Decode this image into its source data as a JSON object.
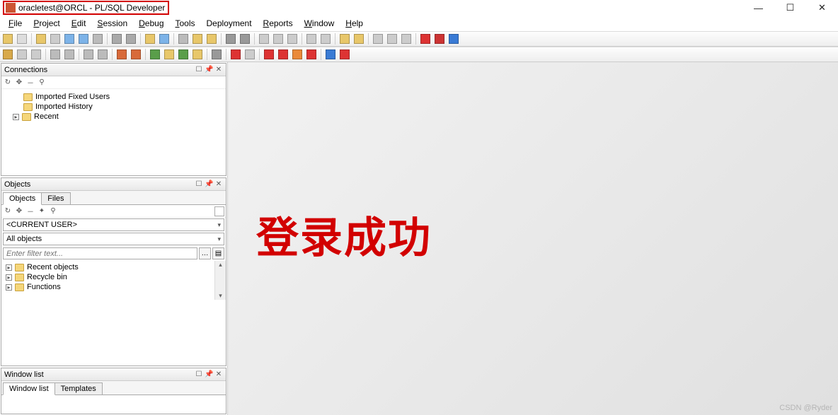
{
  "title": "oracletest@ORCL - PL/SQL Developer",
  "menu": [
    "File",
    "Project",
    "Edit",
    "Session",
    "Debug",
    "Tools",
    "Deployment",
    "Reports",
    "Window",
    "Help"
  ],
  "menu_underline_idx": [
    0,
    0,
    0,
    0,
    0,
    0,
    -1,
    0,
    0,
    0
  ],
  "window_controls": {
    "min": "—",
    "max": "☐",
    "close": "✕"
  },
  "panels": {
    "connections": {
      "title": "Connections",
      "tree": [
        {
          "label": "Imported Fixed Users",
          "exp": false
        },
        {
          "label": "Imported History",
          "exp": false
        },
        {
          "label": "Recent",
          "exp": true
        }
      ]
    },
    "objects": {
      "title": "Objects",
      "tabs": [
        "Objects",
        "Files"
      ],
      "active_tab": 0,
      "current_user": "<CURRENT USER>",
      "scope": "All objects",
      "filter_placeholder": "Enter filter text...",
      "tree": [
        {
          "label": "Recent objects"
        },
        {
          "label": "Recycle bin"
        },
        {
          "label": "Functions"
        }
      ]
    },
    "windowlist": {
      "title": "Window list",
      "tabs": [
        "Window list",
        "Templates"
      ],
      "active_tab": 0
    }
  },
  "overlay_text": "登录成功",
  "watermark": "CSDN @Ryder"
}
